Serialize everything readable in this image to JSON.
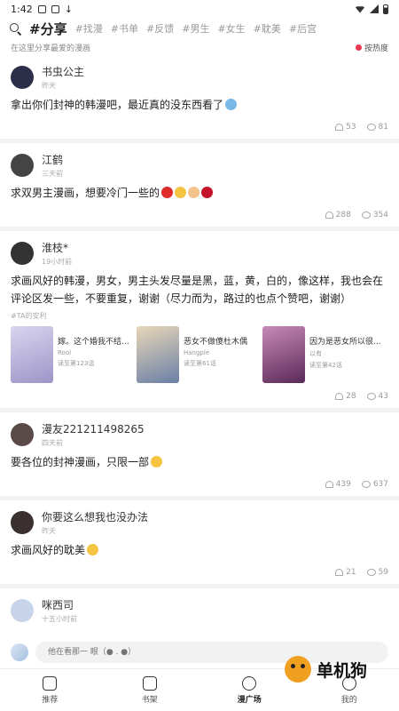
{
  "status_bar": {
    "time": "1:42"
  },
  "tags": {
    "active": "#分享",
    "items": [
      "#找漫",
      "#书单",
      "#反馈",
      "#男生",
      "#女生",
      "#耽美",
      "#后宫"
    ]
  },
  "sub_bar": {
    "hint": "在这里分享最爱的漫画",
    "sort_label": "按热度"
  },
  "posts": [
    {
      "user": "书虫公主",
      "time": "昨天",
      "text": "拿出你们封神的韩漫吧，最近真的没东西看了",
      "likes": "53",
      "comments": "81",
      "avatar_color": "#2b2f4a"
    },
    {
      "user": "江鹤",
      "time": "三天前",
      "text": "求双男主漫画，想要冷门一些的",
      "likes": "288",
      "comments": "354",
      "avatar_color": "#444444"
    },
    {
      "user": "淮枝*",
      "time": "19小时前",
      "text": "求画风好的韩漫，男女，男主头发尽量是黑，蓝，黄，白的，像这样，我也会在评论区发一些，不要重复，谢谢（尽力而为，路过的也点个赞吧，谢谢）",
      "ta_label": "#TA的安利",
      "manga": [
        {
          "title": "嫁。这个婚我不结...",
          "author": "Rool",
          "reads": "读至第123话",
          "cover_color": "#b7b2d6"
        },
        {
          "title": "恶女不做傻杜木偶",
          "author": "Hangple",
          "reads": "读至第61话",
          "cover_color": "#c9b49a"
        },
        {
          "title": "因为是恶女所以很...",
          "author": "以有",
          "reads": "读至第42话",
          "cover_color": "#8a4a7a"
        }
      ],
      "likes": "28",
      "comments": "43",
      "avatar_color": "#333333"
    },
    {
      "user": "漫友221211498265",
      "time": "四天前",
      "text": "要各位的封神漫画，只限一部",
      "likes": "439",
      "comments": "637",
      "avatar_color": "#5a4a4a"
    },
    {
      "user": "你要这么想我也没办法",
      "time": "昨天",
      "text": "求画风好的耽美",
      "likes": "21",
      "comments": "59",
      "avatar_color": "#3a3030"
    },
    {
      "user": "咪西司",
      "time": "十五小时前",
      "avatar_color": "#c8d4ea"
    }
  ],
  "comment_bar": {
    "placeholder": "他在看那一 眼（● . ●）"
  },
  "tabs": [
    {
      "label": "推荐"
    },
    {
      "label": "书架"
    },
    {
      "label": "漫广场"
    },
    {
      "label": "我的"
    }
  ],
  "watermark": {
    "text": "单机狗"
  }
}
